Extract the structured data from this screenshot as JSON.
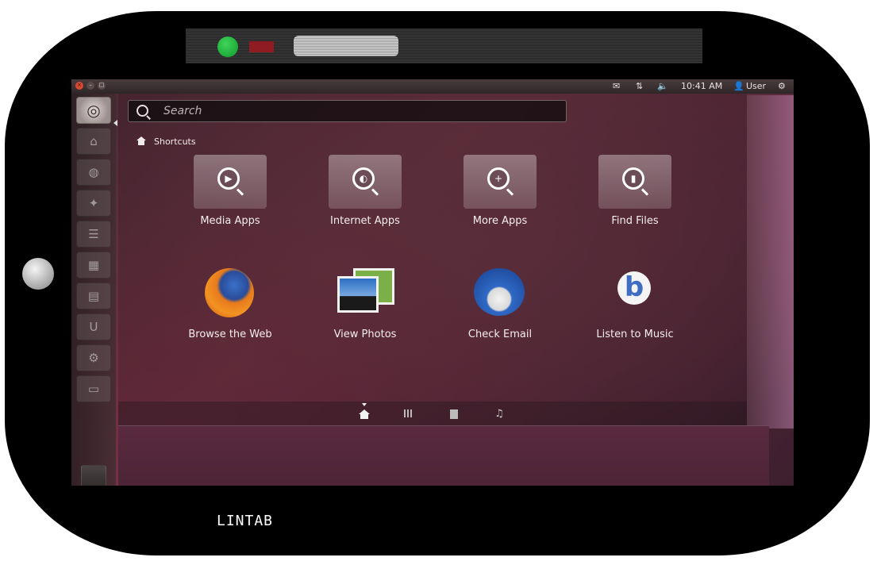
{
  "device": {
    "brand_label": "LINTAB"
  },
  "top_panel": {
    "time": "10:41 AM",
    "user": "User"
  },
  "dash": {
    "search": {
      "placeholder": "Search"
    },
    "section_title": "Shortcuts",
    "lens_shortcuts": [
      {
        "label": "Media Apps",
        "icon": "play-lens-icon"
      },
      {
        "label": "Internet Apps",
        "icon": "globe-lens-icon"
      },
      {
        "label": "More Apps",
        "icon": "plus-lens-icon"
      },
      {
        "label": "Find Files",
        "icon": "file-lens-icon"
      }
    ],
    "app_shortcuts": [
      {
        "label": "Browse the Web",
        "icon": "firefox-icon"
      },
      {
        "label": "View Photos",
        "icon": "photos-icon"
      },
      {
        "label": "Check Email",
        "icon": "thunderbird-icon"
      },
      {
        "label": "Listen to Music",
        "icon": "music-player-icon"
      }
    ]
  },
  "colors": {
    "bezel": "#000000",
    "accent": "#dd4814",
    "wallpaper": "#5e2c3c"
  }
}
